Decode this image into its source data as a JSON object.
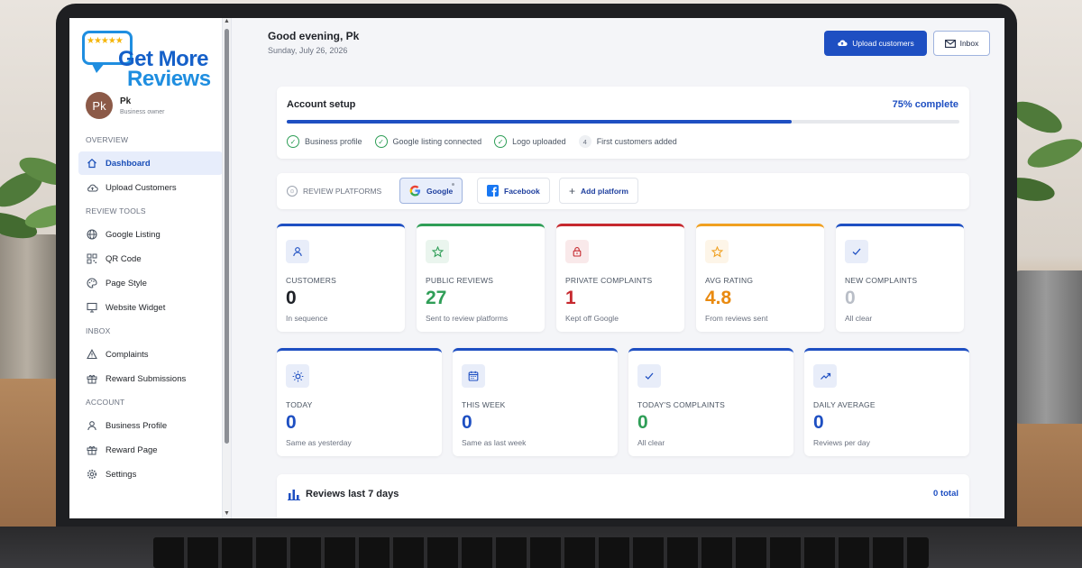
{
  "app": {
    "logo_line1": "Get More",
    "logo_line2": "Reviews",
    "logo_stars": "★★★★★"
  },
  "user": {
    "initials": "Pk",
    "name": "Pk",
    "role": "Business owner"
  },
  "sidebar": {
    "sections": [
      {
        "title": "OVERVIEW",
        "items": [
          {
            "label": "Dashboard",
            "icon": "home-icon",
            "active": true
          },
          {
            "label": "Upload Customers",
            "icon": "cloud-upload-icon"
          }
        ]
      },
      {
        "title": "REVIEW TOOLS",
        "items": [
          {
            "label": "Google Listing",
            "icon": "globe-icon"
          },
          {
            "label": "QR Code",
            "icon": "qr-code-icon"
          },
          {
            "label": "Page Style",
            "icon": "palette-icon"
          },
          {
            "label": "Website Widget",
            "icon": "monitor-icon"
          }
        ]
      },
      {
        "title": "INBOX",
        "items": [
          {
            "label": "Complaints",
            "icon": "warning-icon"
          },
          {
            "label": "Reward Submissions",
            "icon": "gift-icon"
          }
        ]
      },
      {
        "title": "ACCOUNT",
        "items": [
          {
            "label": "Business Profile",
            "icon": "person-icon"
          },
          {
            "label": "Reward Page",
            "icon": "gift-icon"
          },
          {
            "label": "Settings",
            "icon": "gear-icon"
          }
        ]
      }
    ]
  },
  "header": {
    "greeting": "Good evening, Pk",
    "date": "Sunday, July 26, 2026",
    "upload_label": "Upload customers",
    "inbox_label": "Inbox"
  },
  "setup": {
    "title": "Account setup",
    "percent_label": "75% complete",
    "progress": 0.75,
    "steps": [
      {
        "label": "Business profile",
        "done": true
      },
      {
        "label": "Google listing connected",
        "done": true
      },
      {
        "label": "Logo uploaded",
        "done": true
      },
      {
        "label": "First customers added",
        "done": false,
        "number": "4"
      }
    ]
  },
  "platforms": {
    "label": "REVIEW PLATFORMS",
    "google": "Google",
    "facebook": "Facebook",
    "add": "Add platform"
  },
  "stats_row1": [
    {
      "label": "CUSTOMERS",
      "value": "0",
      "sub": "In sequence",
      "color": "#1f2228",
      "accent": "#1e4fc2",
      "icon": "person-icon"
    },
    {
      "label": "PUBLIC REVIEWS",
      "value": "27",
      "sub": "Sent to review platforms",
      "color": "#2f9e57",
      "accent": "#2f9e57",
      "icon": "star-icon"
    },
    {
      "label": "PRIVATE COMPLAINTS",
      "value": "1",
      "sub": "Kept off Google",
      "color": "#c6282e",
      "accent": "#c6282e",
      "icon": "lock-icon"
    },
    {
      "label": "AVG RATING",
      "value": "4.8",
      "sub": "From reviews sent",
      "color": "#e98a10",
      "accent": "#f0a020",
      "icon": "star-icon"
    },
    {
      "label": "NEW COMPLAINTS",
      "value": "0",
      "sub": "All clear",
      "color": "#b9bec7",
      "accent": "#1e4fc2",
      "icon": "check-icon"
    }
  ],
  "stats_row2": [
    {
      "label": "TODAY",
      "value": "0",
      "sub": "Same as yesterday",
      "color": "#1e4fc2",
      "accent": "#1e4fc2",
      "icon": "sun-icon"
    },
    {
      "label": "THIS WEEK",
      "value": "0",
      "sub": "Same as last week",
      "color": "#1e4fc2",
      "accent": "#1e4fc2",
      "icon": "calendar-icon"
    },
    {
      "label": "TODAY'S COMPLAINTS",
      "value": "0",
      "sub": "All clear",
      "color": "#2f9e57",
      "accent": "#1e4fc2",
      "icon": "check-icon"
    },
    {
      "label": "DAILY AVERAGE",
      "value": "0",
      "sub": "Reviews per day",
      "color": "#1e4fc2",
      "accent": "#1e4fc2",
      "icon": "trend-icon"
    }
  ],
  "reviews_chart": {
    "title": "Reviews last 7 days",
    "total": "0 total"
  }
}
